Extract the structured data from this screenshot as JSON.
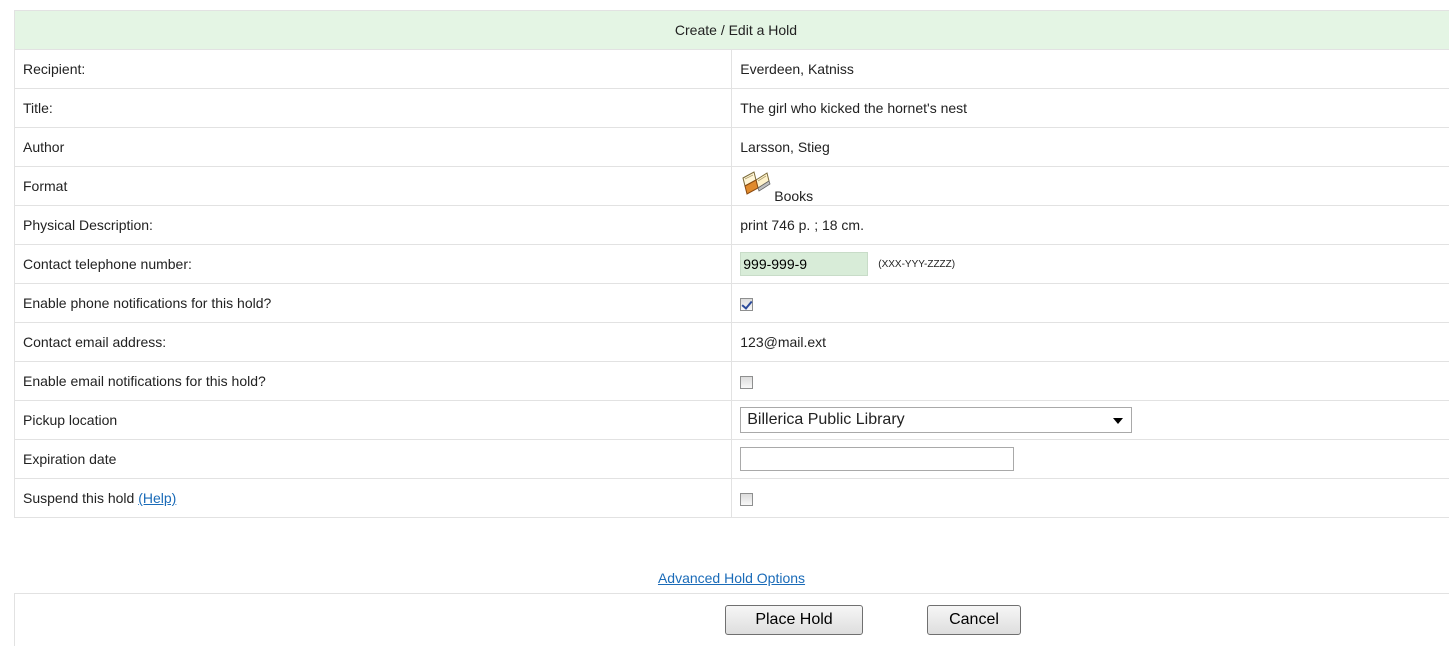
{
  "header": {
    "title": "Create / Edit a Hold"
  },
  "rows": {
    "recipient": {
      "label": "Recipient:",
      "value": "Everdeen, Katniss"
    },
    "title": {
      "label": "Title:",
      "value": "The girl who kicked the hornet's nest"
    },
    "author": {
      "label": "Author",
      "value": "Larsson, Stieg"
    },
    "format": {
      "label": "Format",
      "value": "Books",
      "icon": "book-icon"
    },
    "physical": {
      "label": "Physical Description:",
      "value": "print 746 p. ; 18 cm."
    },
    "phone": {
      "label": "Contact telephone number:",
      "value": "999-999-9",
      "hint": "(XXX-YYY-ZZZZ)"
    },
    "phone_notify": {
      "label": "Enable phone notifications for this hold?",
      "checked": true
    },
    "email": {
      "label": "Contact email address:",
      "value": "123@mail.ext"
    },
    "email_notify": {
      "label": "Enable email notifications for this hold?",
      "checked": false
    },
    "pickup": {
      "label": "Pickup location",
      "value": "Billerica Public Library"
    },
    "expiration": {
      "label": "Expiration date",
      "value": ""
    },
    "suspend": {
      "label": "Suspend this hold",
      "help_label": "(Help)",
      "checked": false
    }
  },
  "advanced_link": "Advanced Hold Options",
  "buttons": {
    "place_hold": "Place Hold",
    "cancel": "Cancel"
  },
  "colors": {
    "header_bg": "#e4f5e4",
    "link": "#1a6bb8",
    "phone_bg": "#d8ecd8"
  }
}
